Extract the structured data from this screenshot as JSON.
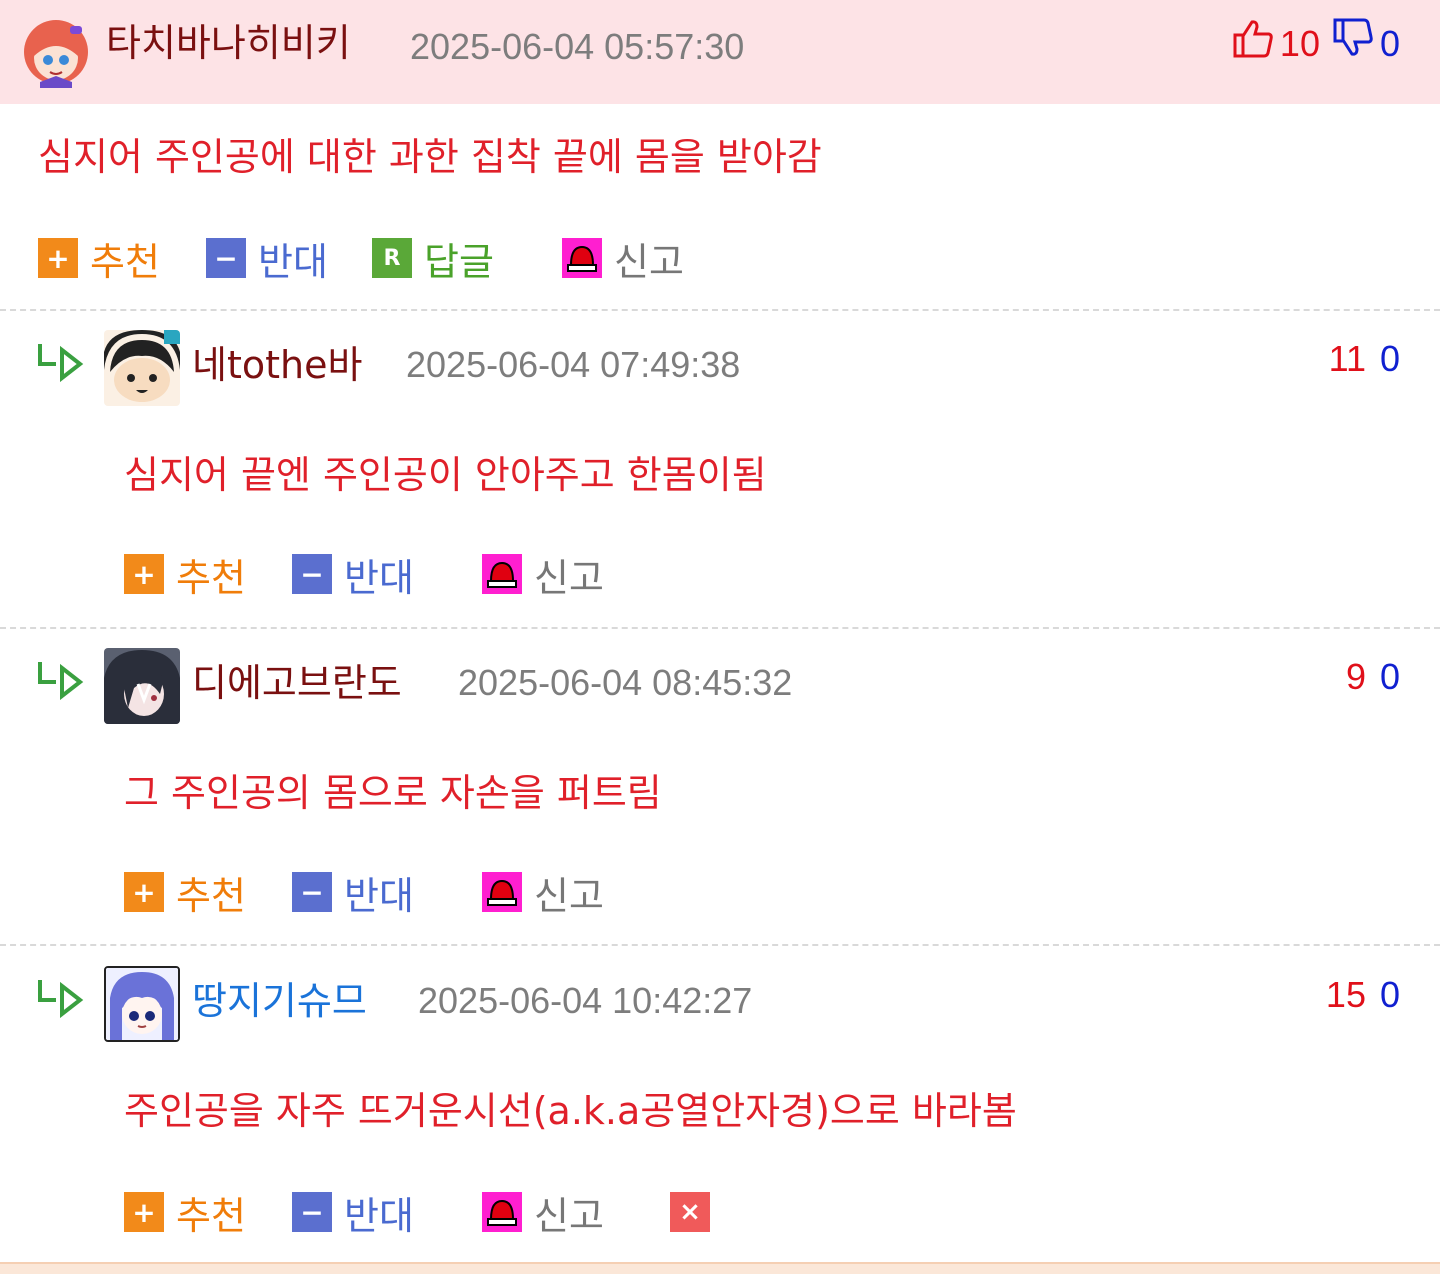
{
  "colors": {
    "header_bg": "#fde3e6",
    "upvote": "#e0101a",
    "downvote": "#1020d0",
    "comment_text": "#e0202a",
    "nick": "#7a1010"
  },
  "comments": [
    {
      "nick": "타치바나히비키",
      "time": "2025-06-04 05:57:30",
      "up": "10",
      "down": "0",
      "text": "심지어 주인공에 대한 과한 집착 끝에 몸을 받아감",
      "avatar_icon": "anime-girl-avatar",
      "actions": {
        "recommend": "추천",
        "oppose": "반대",
        "reply": "답글",
        "report": "신고"
      }
    },
    {
      "nick": "네tothe바",
      "time": "2025-06-04 07:49:38",
      "up": "11",
      "down": "0",
      "text": "심지어 끝엔 주인공이 안아주고 한몸이됨",
      "avatar_icon": "chibi-avatar",
      "actions": {
        "recommend": "추천",
        "oppose": "반대",
        "report": "신고"
      }
    },
    {
      "nick": "디에고브란도",
      "time": "2025-06-04 08:45:32",
      "up": "9",
      "down": "0",
      "text": "그 주인공의 몸으로 자손을 퍼트림",
      "avatar_icon": "dark-hair-avatar",
      "actions": {
        "recommend": "추천",
        "oppose": "반대",
        "report": "신고"
      }
    },
    {
      "nick": "땅지기슈므",
      "time": "2025-06-04 10:42:27",
      "up": "15",
      "down": "0",
      "text": "주인공을 자주 뜨거운시선(a.k.a공열안자경)으로 바라봄",
      "avatar_icon": "blue-hair-avatar",
      "actions": {
        "recommend": "추천",
        "oppose": "반대",
        "report": "신고",
        "delete": "×"
      }
    }
  ]
}
